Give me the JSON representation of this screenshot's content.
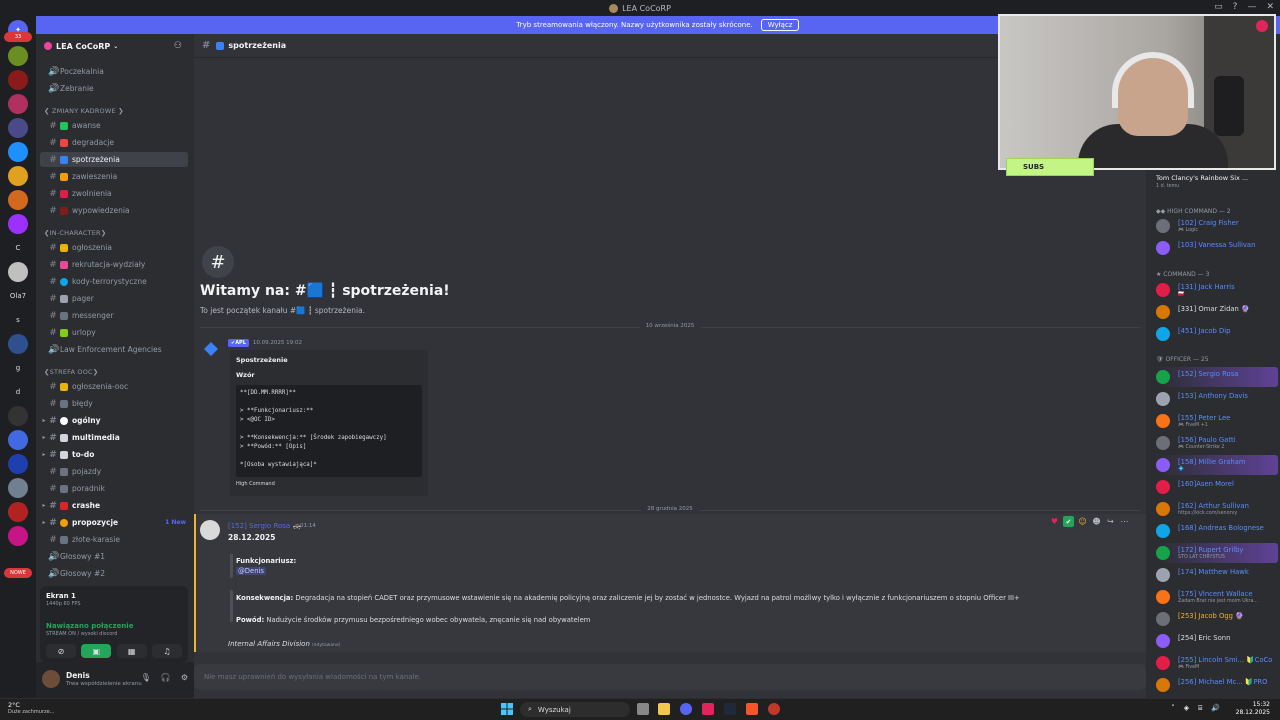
{
  "window": {
    "title": "LEA CoCoRP"
  },
  "banner": {
    "text": "Tryb streamowania włączony. Nazwy użytkownika zostały skrócone.",
    "button": "Wyłącz"
  },
  "rail": {
    "badge_top": "33",
    "label_c": "C",
    "label_ola": "Ola7",
    "label_s": "s",
    "label_g": "g",
    "label_d": "d",
    "badge_bottom": "NOWE"
  },
  "guild": {
    "name": "LEA CoCoRP"
  },
  "channels": {
    "poczekalnia": "Poczekalnia",
    "zebranie": "Zebranie",
    "cat_zmiany": "❮ ZMIANY KADROWE ❯",
    "awanse": "awanse",
    "degradacje": "degradacje",
    "spostrzezenia": "spotrzeżenia",
    "zawieszenia": "zawieszenia",
    "zwolnienia": "zwolnienia",
    "wypowiedzenia": "wypowiedzenia",
    "cat_ic": "❮IN-CHARACTER❯",
    "ogloszenia": "ogłoszenia",
    "rekrutacja": "rekrutacja-wydziały",
    "kody": "kody-terrorystyczne",
    "pager": "pager",
    "messenger": "messenger",
    "urlopy": "urlopy",
    "lea": "Law Enforcement Agencies",
    "cat_ooc": "❮STREFA OOC❯",
    "ogloszenia_ooc": "ogłoszenia-ooc",
    "bledy": "błędy",
    "ogolny": "ogólny",
    "multimedia": "multimedia",
    "todo": "to-do",
    "pojazdy": "pojazdy",
    "poradnik": "poradnik",
    "crashe": "crashe",
    "propozycje": "propozycje",
    "propozycje_new": "1 New",
    "zlote": "złote-karasie",
    "glosowy1": "Głosowy #1",
    "glosowy2": "Głosowy #2"
  },
  "voice": {
    "stream_title": "Ekran 1",
    "stream_sub": "1440p 60 FPS",
    "status": "Nawiązano połączenie",
    "status_sub": "STREAM ON / wysoki discord"
  },
  "user": {
    "name": "Denis",
    "status": "Trwa współdzielenie ekranu"
  },
  "chat": {
    "channel_name": "spotrzeżenia",
    "welcome_title": "Witamy na: #🟦 ┇ spotrzeżenia!",
    "welcome_sub": "To jest początek kanału #🟦 ┇ spotrzeżenia.",
    "date1": "10 września 2025",
    "msg1_tag": "✔APL",
    "msg1_time": "10.09.2025 19:02",
    "embed_title": "Spostrzeżenie",
    "embed_sub": "Wzór",
    "embed_code": "**[DD.MM.RRRR]**\n\n> **Funkcjonariusz:**\n> <@OC ID>\n\n> **Konsekwencja:** [Środek zapobiegawczy]\n> **Powód:** [Opis]\n\n*[Osoba wystawiająca]*",
    "embed_footer": "High Command",
    "date2": "28 grudnia 2025",
    "msg2_author": "[152] Sergio Rosa 🚓",
    "msg2_time": "01:14",
    "msg2_date": "28.12.2025",
    "officer_label": "Funkcjonariusz:",
    "officer_mention": "@Denis",
    "consequence_label": "Konsekwencja:",
    "consequence_text": "Degradacja na stopień CADET oraz przymusowe wstawienie się na akademię policyjną oraz zaliczenie jej by zostać w jednostce. Wyjazd na patrol możliwy tylko i wyłącznie z funkcjonariuszem o stopniu Officer III+",
    "reason_label": "Powód:",
    "reason_text": "Nadużycie środków przymusu bezpośredniego wobec obywatela, znęcanie się nad obywatelem",
    "signature": "Internal Affairs Division",
    "signature_edit": "(edytowane)",
    "composer_placeholder": "Nie masz uprawnień do wysyłania wiadomości na tym kanale."
  },
  "overlay": {
    "subs_label": "SUBS",
    "game_title": "Tom Clancy's Rainbow Six ...",
    "game_sub": "1 d. temu"
  },
  "members": {
    "sec_high": "◆◆ HIGH COMMAND — 2",
    "sec_command": "★ COMMAND — 3",
    "sec_officer": "🛡 OFFICER — 25",
    "list_high": [
      {
        "name": "[102] Craig Fisher",
        "sub": "🎮 Logic",
        "color": "#5b8cff"
      },
      {
        "name": "[103] Vanessa Sullivan",
        "sub": "",
        "color": "#5b8cff"
      }
    ],
    "list_command": [
      {
        "name": "[131] Jack Harris",
        "sub": "🇵🇱",
        "color": "#5b8cff"
      },
      {
        "name": "[331] Omar Zidan 🔮",
        "sub": "",
        "color": "#dbdee1"
      },
      {
        "name": "[451] Jacob Dip",
        "sub": "",
        "color": "#5b8cff"
      }
    ],
    "list_officer": [
      {
        "name": "[152] Sergio Rosa",
        "sub": "",
        "color": "#5b8cff"
      },
      {
        "name": "[153] Anthony Davis",
        "sub": "",
        "color": "#5b8cff"
      },
      {
        "name": "[155] Peter Lee",
        "sub": "🎮 FiveM +1",
        "color": "#5b8cff"
      },
      {
        "name": "[156] Paulo Gatti",
        "sub": "🎮 Counter-Strike 2",
        "color": "#5b8cff"
      },
      {
        "name": "[158] Millie Graham",
        "sub": "💠",
        "color": "#5b8cff"
      },
      {
        "name": "[160]Asen Morel",
        "sub": "",
        "color": "#5b8cff"
      },
      {
        "name": "[162] Arthur Sullivan",
        "sub": "https://kick.com/senorvy",
        "color": "#5b8cff"
      },
      {
        "name": "[168] Andreas Bolognese",
        "sub": "",
        "color": "#5b8cff"
      },
      {
        "name": "[172] Rupert Grilby",
        "sub": "STO LAT CHRYSTUS",
        "color": "#5b8cff"
      },
      {
        "name": "[174] Matthew Hawk",
        "sub": "",
        "color": "#5b8cff"
      },
      {
        "name": "[175] Vincent Wallace",
        "sub": "Zadam Brat nie jest moim Ukra...",
        "color": "#5b8cff"
      },
      {
        "name": "[253] Jacob Ogg 🔮",
        "sub": "",
        "color": "#f0b232"
      },
      {
        "name": "[254] Eric Sonn",
        "sub": "",
        "color": "#dbdee1"
      },
      {
        "name": "[255] Lincoln Smi... 🔰CoCo",
        "sub": "🎮 FiveM",
        "color": "#5b8cff"
      },
      {
        "name": "[256] Michael Mc... 🔰PRO",
        "sub": "",
        "color": "#5b8cff"
      }
    ]
  },
  "taskbar": {
    "weather_temp": "2°C",
    "weather_desc": "Duże zachmurze...",
    "search": "Wyszukaj",
    "time": "15:32",
    "date": "28.12.2025"
  }
}
